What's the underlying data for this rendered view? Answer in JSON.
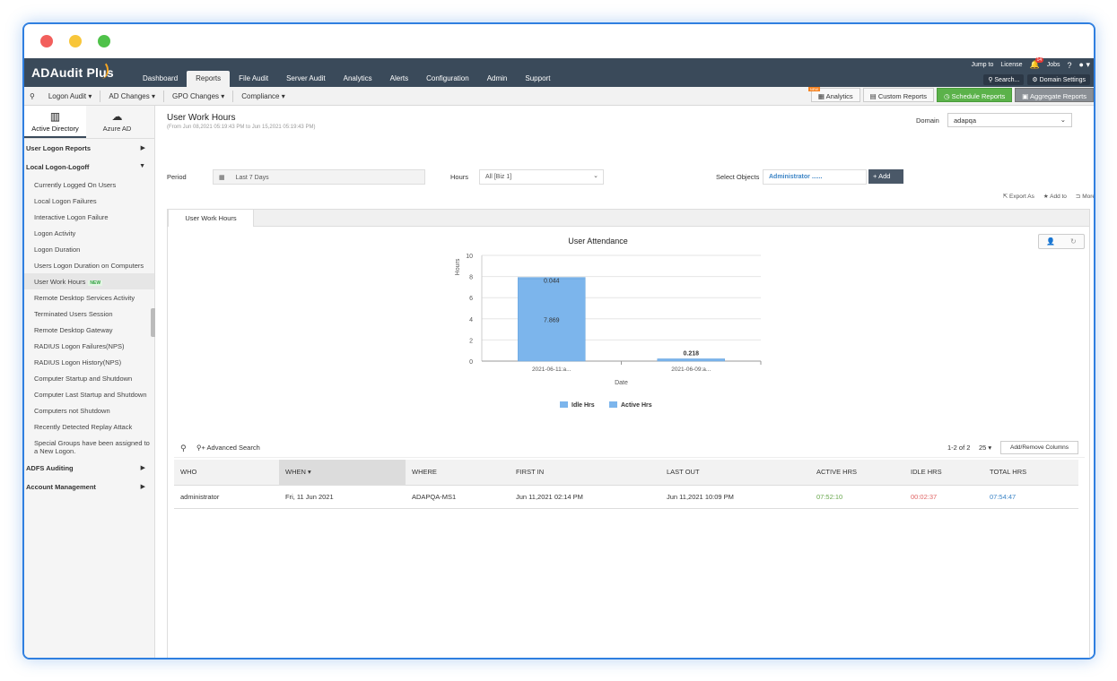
{
  "app": {
    "name": "ADAudit Plus",
    "nav_tabs": [
      "Dashboard",
      "Reports",
      "File Audit",
      "Server Audit",
      "Analytics",
      "Alerts",
      "Configuration",
      "Admin",
      "Support"
    ],
    "active_tab": "Reports",
    "top_links": {
      "jump": "Jump to",
      "license": "License",
      "bell_count": "14",
      "jobs": "Jobs",
      "help": "?"
    },
    "search_label": "Search...",
    "domain_settings_label": "Domain Settings"
  },
  "subnav": {
    "items": [
      "Logon Audit",
      "AD Changes",
      "GPO Changes",
      "Compliance"
    ],
    "analytics": "Analytics",
    "new_flag": "NEW",
    "custom_reports": "Custom Reports",
    "schedule_reports": "Schedule Reports",
    "aggregate_reports": "Aggregate Reports"
  },
  "sidebar": {
    "tabs": [
      "Active Directory",
      "Azure AD"
    ],
    "sections": {
      "user_logon_reports": "User Logon Reports",
      "local_logon_logoff": "Local Logon-Logoff",
      "adfs_auditing": "ADFS Auditing",
      "account_management": "Account Management"
    },
    "items": [
      "Currently Logged On Users",
      "Local Logon Failures",
      "Interactive Logon Failure",
      "Logon Activity",
      "Logon Duration",
      "Users Logon Duration on Computers",
      "User Work Hours",
      "Remote Desktop Services Activity",
      "Terminated Users Session",
      "Remote Desktop Gateway",
      "RADIUS Logon Failures(NPS)",
      "RADIUS Logon History(NPS)",
      "Computer Startup and Shutdown",
      "Computer Last Startup and Shutdown",
      "Computers not Shutdown",
      "Recently Detected Replay Attack",
      "Special Groups have been assigned to a New Logon."
    ],
    "new_tag": "NEW"
  },
  "report": {
    "title": "User Work Hours",
    "subtitle": "(From Jun 08,2021 05:19:43 PM to Jun 15,2021 05:19:43 PM)",
    "domain_label": "Domain",
    "domain_value": "adapqa",
    "period_label": "Period",
    "period_value": "Last 7 Days",
    "hours_label": "Hours",
    "hours_value": "All [Biz 1]",
    "select_objects_label": "Select Objects",
    "select_objects_value": "Administrator ......",
    "add_label": "Add",
    "export_label": "Export As",
    "addto_label": "Add to",
    "more_label": "More",
    "panel_tab": "User Work Hours"
  },
  "chart_data": {
    "type": "bar",
    "title": "User Attendance",
    "xlabel": "Date",
    "ylabel": "Hours",
    "categories": [
      "2021-06-11:a...",
      "2021-06-09:a..."
    ],
    "series": [
      {
        "name": "Idle Hrs",
        "values": [
          0.044,
          0.218
        ]
      },
      {
        "name": "Active Hrs",
        "values": [
          7.869,
          0
        ]
      }
    ],
    "data_labels": [
      "0.044",
      "7.869",
      "0.218"
    ],
    "ylim": [
      0,
      10
    ],
    "yticks": [
      0,
      2,
      4,
      6,
      8,
      10
    ],
    "colors": {
      "bar": "#7cb5ec"
    },
    "legend_position": "bottom"
  },
  "grid": {
    "advanced_search": "Advanced Search",
    "page_info": "1-2 of 2",
    "per_page": "25",
    "add_remove_columns": "Add/Remove Columns",
    "columns": [
      "WHO",
      "WHEN",
      "WHERE",
      "FIRST IN",
      "LAST OUT",
      "ACTIVE HRS",
      "IDLE HRS",
      "TOTAL HRS"
    ],
    "rows": [
      [
        "administrator",
        "Fri, 11 Jun 2021",
        "ADAPQA-MS1",
        "Jun 11,2021 02:14 PM",
        "Jun 11,2021 10:09 PM",
        "07:52:10",
        "00:02:37",
        "07:54:47"
      ]
    ]
  }
}
